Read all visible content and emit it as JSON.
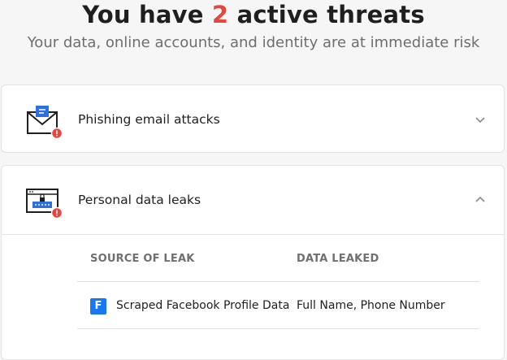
{
  "header": {
    "title_prefix": "You have",
    "threat_count": "2",
    "title_suffix": "active threats",
    "subtitle": "Your data, online accounts, and identity are at immediate risk"
  },
  "threats": [
    {
      "title": "Phishing email attacks",
      "icon": "phishing-email-icon",
      "expanded": false
    },
    {
      "title": "Personal data leaks",
      "icon": "data-leak-icon",
      "expanded": true
    }
  ],
  "leaks_table": {
    "headers": [
      "SOURCE OF LEAK",
      "DATA LEAKED"
    ],
    "rows": [
      {
        "source_icon": "F",
        "source": "Scraped Facebook Profile Data",
        "data": "Full Name, Phone Number"
      }
    ]
  },
  "colors": {
    "accent_red": "#e8453c",
    "icon_blue": "#2b6fe0",
    "facebook_blue": "#1877f2"
  }
}
